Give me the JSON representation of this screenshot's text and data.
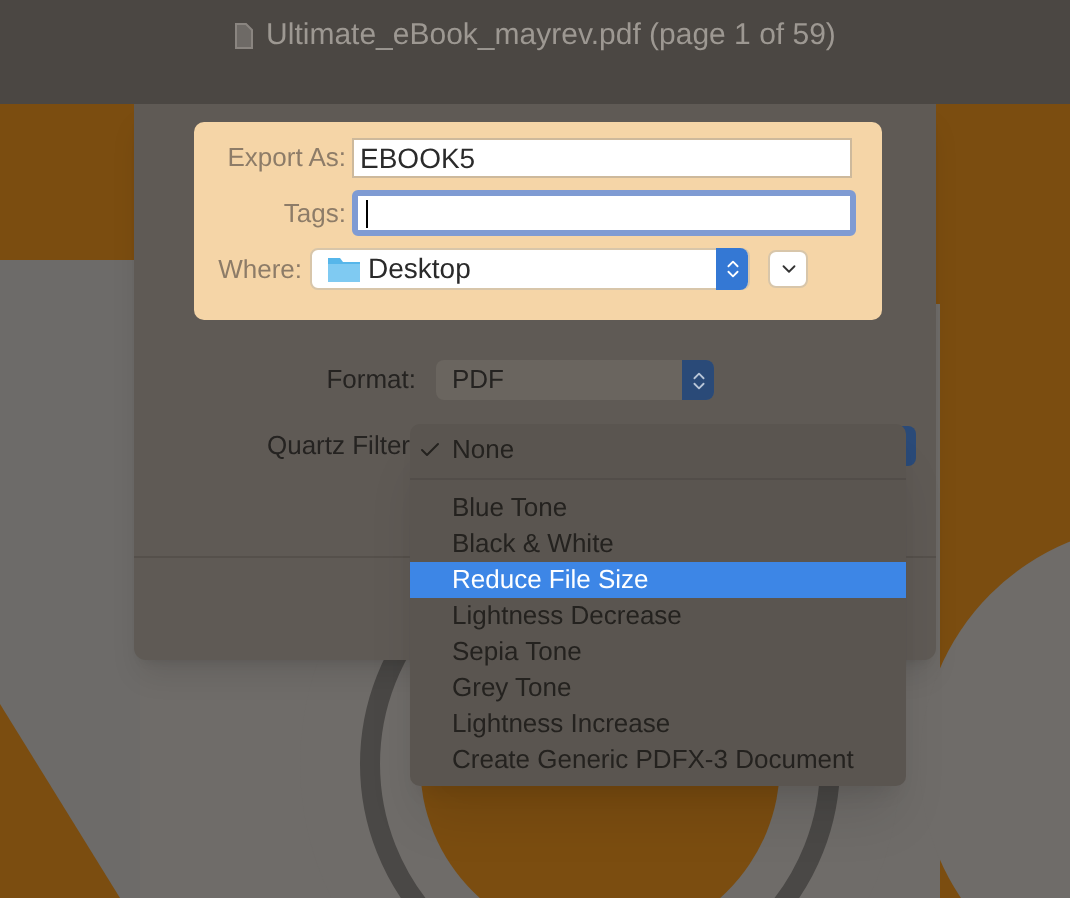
{
  "window": {
    "title": "Ultimate_eBook_mayrev.pdf (page 1 of 59)"
  },
  "save_panel": {
    "export_as": {
      "label": "Export As:",
      "value": "EBOOK5"
    },
    "tags": {
      "label": "Tags:",
      "focused": true
    },
    "where": {
      "label": "Where:",
      "value": "Desktop"
    }
  },
  "format": {
    "label": "Format:",
    "value": "PDF"
  },
  "quartz_filter": {
    "label": "Quartz Filter",
    "menu": [
      {
        "label": "None",
        "checked": true,
        "selected": false,
        "separator_after": true
      },
      {
        "label": "Blue Tone",
        "checked": false,
        "selected": false,
        "separator_after": false
      },
      {
        "label": "Black & White",
        "checked": false,
        "selected": false,
        "separator_after": false
      },
      {
        "label": "Reduce File Size",
        "checked": false,
        "selected": true,
        "separator_after": false
      },
      {
        "label": "Lightness Decrease",
        "checked": false,
        "selected": false,
        "separator_after": false
      },
      {
        "label": "Sepia Tone",
        "checked": false,
        "selected": false,
        "separator_after": false
      },
      {
        "label": "Grey Tone",
        "checked": false,
        "selected": false,
        "separator_after": false
      },
      {
        "label": "Lightness Increase",
        "checked": false,
        "selected": false,
        "separator_after": false
      },
      {
        "label": "Create Generic PDFX-3 Document",
        "checked": false,
        "selected": false,
        "separator_after": false
      }
    ]
  }
}
